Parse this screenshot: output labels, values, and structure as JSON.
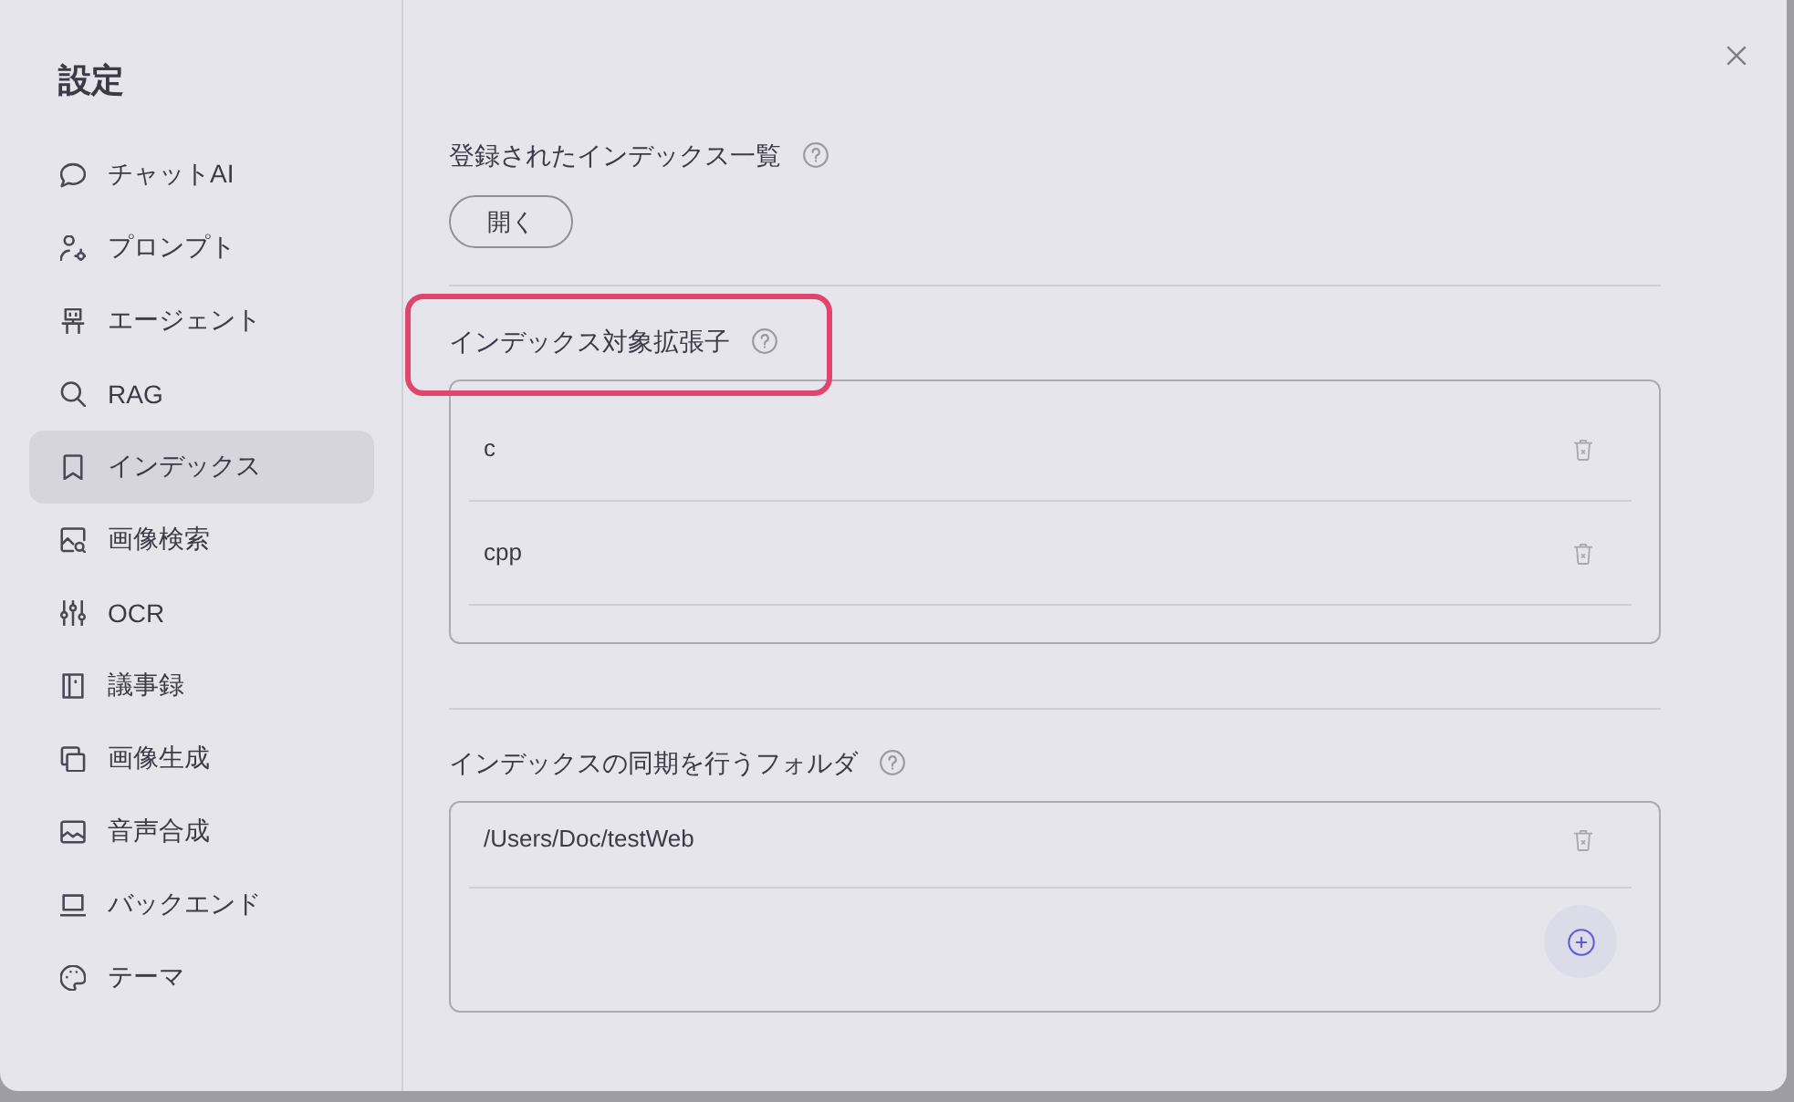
{
  "sidebar": {
    "title": "設定",
    "items": [
      {
        "label": "チャットAI",
        "kind": "chat",
        "selected": false
      },
      {
        "label": "プロンプト",
        "kind": "prompt",
        "selected": false
      },
      {
        "label": "エージェント",
        "kind": "agent",
        "selected": false
      },
      {
        "label": "RAG",
        "kind": "search",
        "selected": false
      },
      {
        "label": "インデックス",
        "kind": "bookmark",
        "selected": true
      },
      {
        "label": "画像検索",
        "kind": "image-search",
        "selected": false
      },
      {
        "label": "OCR",
        "kind": "sliders",
        "selected": false
      },
      {
        "label": "議事録",
        "kind": "notebook",
        "selected": false
      },
      {
        "label": "画像生成",
        "kind": "copy",
        "selected": false
      },
      {
        "label": "音声合成",
        "kind": "image",
        "selected": false
      },
      {
        "label": "バックエンド",
        "kind": "laptop",
        "selected": false
      },
      {
        "label": "テーマ",
        "kind": "palette",
        "selected": false
      }
    ]
  },
  "sections": [
    {
      "kind": "button",
      "title": "登録されたインデックス一覧",
      "highlighted": false,
      "button": "開く"
    },
    {
      "kind": "list",
      "title": "インデックス対象拡張子",
      "highlighted": true,
      "items": [
        "c",
        "cpp"
      ]
    },
    {
      "kind": "folder-list",
      "title": "インデックスの同期を行うフォルダ",
      "highlighted": false,
      "items": [
        "/Users/Doc/testWeb"
      ]
    }
  ]
}
